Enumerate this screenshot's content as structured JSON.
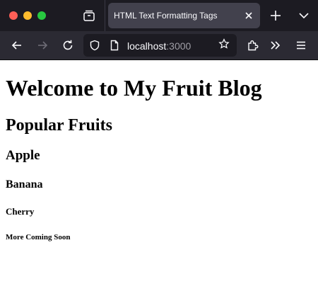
{
  "browser": {
    "tab_title": "HTML Text Formatting Tags",
    "url_host": "localhost",
    "url_port": ":3000"
  },
  "page": {
    "h1": "Welcome to My Fruit Blog",
    "h2": "Popular Fruits",
    "h3": "Apple",
    "h4": "Banana",
    "h5": "Cherry",
    "h6": "More Coming Soon"
  },
  "colors": {
    "titlebar": "#1c1b22",
    "toolbar": "#2b2a33",
    "active_tab": "#42414d",
    "close_red": "#fe5f57",
    "minimize_yellow": "#febc2e",
    "zoom_green": "#28c840"
  },
  "icons": [
    "close-window",
    "minimize-window",
    "zoom-window",
    "tab-list-icon",
    "close-icon",
    "plus-icon",
    "chevron-down-icon",
    "back-arrow-icon",
    "forward-arrow-icon",
    "reload-icon",
    "shield-icon",
    "page-icon",
    "star-icon",
    "extensions-icon",
    "overflow-icon",
    "hamburger-menu-icon"
  ]
}
